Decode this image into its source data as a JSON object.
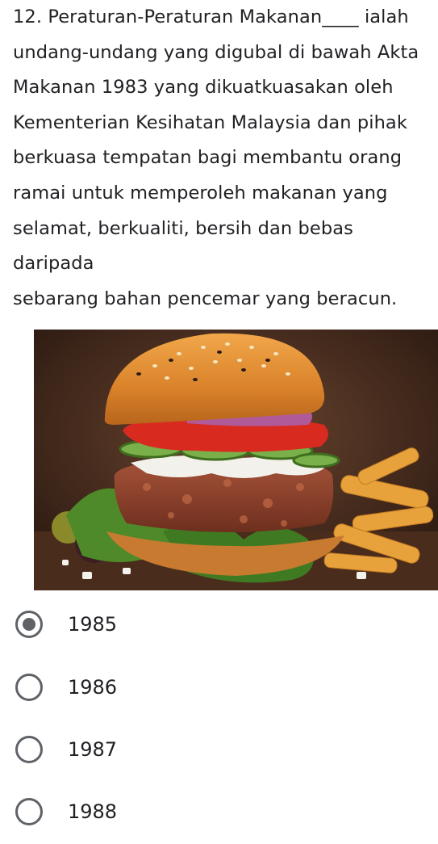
{
  "question": {
    "text": "12. Peraturan-Peraturan Makanan____ ialah\nundang-undang yang digubal di bawah Akta\nMakanan 1983 yang dikuatkuasakan oleh\nKementerian Kesihatan Malaysia dan pihak\nberkuasa tempatan bagi membantu orang\nramai untuk memperoleh makanan yang\nselamat, berkualiti, bersih dan bebas daripada\nsebarang bahan pencemar yang beracun."
  },
  "image": {
    "subject": "burger-with-fries-photo"
  },
  "options": [
    {
      "label": "1985",
      "selected": true
    },
    {
      "label": "1986",
      "selected": false
    },
    {
      "label": "1987",
      "selected": false
    },
    {
      "label": "1988",
      "selected": false
    }
  ],
  "colors": {
    "radio": "#5f6368",
    "text": "#202124",
    "background": "#ffffff"
  }
}
